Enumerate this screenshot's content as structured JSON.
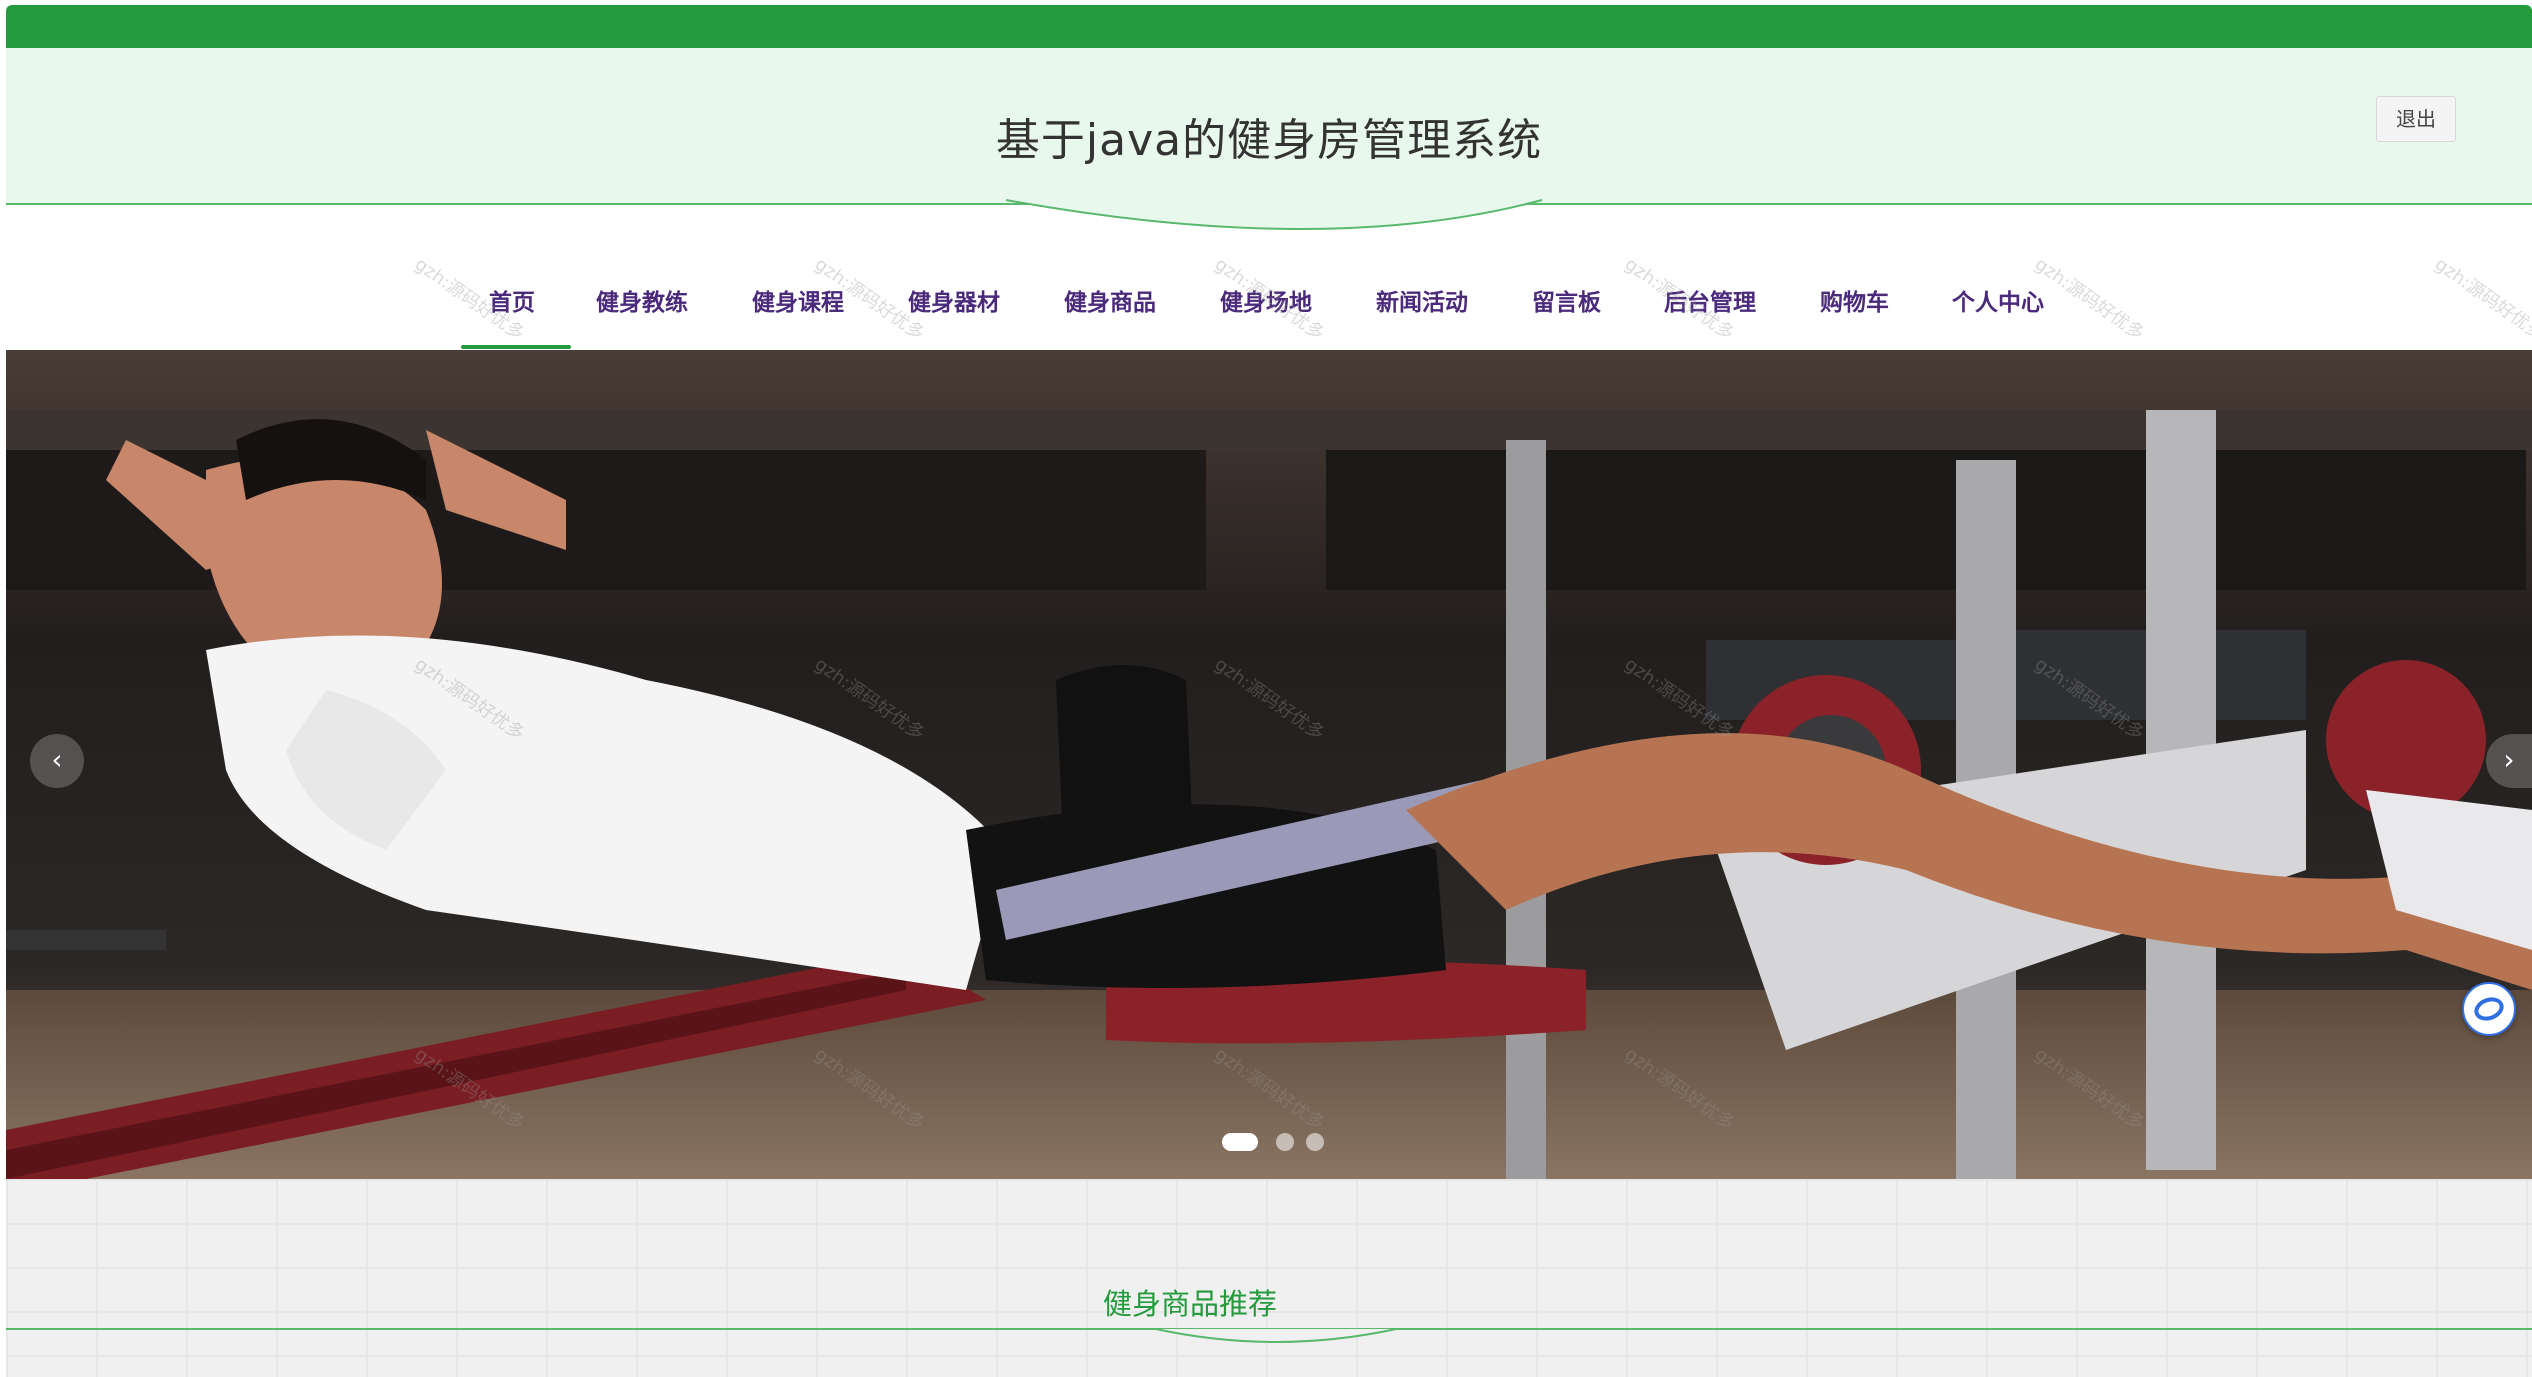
{
  "header": {
    "title": "基于java的健身房管理系统",
    "logout_label": "退出"
  },
  "nav": {
    "items": [
      {
        "label": "首页",
        "active": true
      },
      {
        "label": "健身教练"
      },
      {
        "label": "健身课程"
      },
      {
        "label": "健身器材"
      },
      {
        "label": "健身商品"
      },
      {
        "label": "健身场地"
      },
      {
        "label": "新闻活动"
      },
      {
        "label": "留言板"
      },
      {
        "label": "后台管理"
      },
      {
        "label": "购物车"
      },
      {
        "label": "个人中心"
      }
    ]
  },
  "carousel": {
    "prev_icon": "chevron-left-icon",
    "next_icon": "chevron-right-icon",
    "prev_glyph": "‹",
    "next_glyph": "›",
    "slide_count": 3,
    "active_index": 0
  },
  "section": {
    "title": "健身商品推荐"
  },
  "watermark": {
    "text": "gzh:源码好优多"
  },
  "colors": {
    "brand_green": "#239a3b",
    "header_bg": "#e9f8ec",
    "nav_text": "#4b2a7c"
  }
}
